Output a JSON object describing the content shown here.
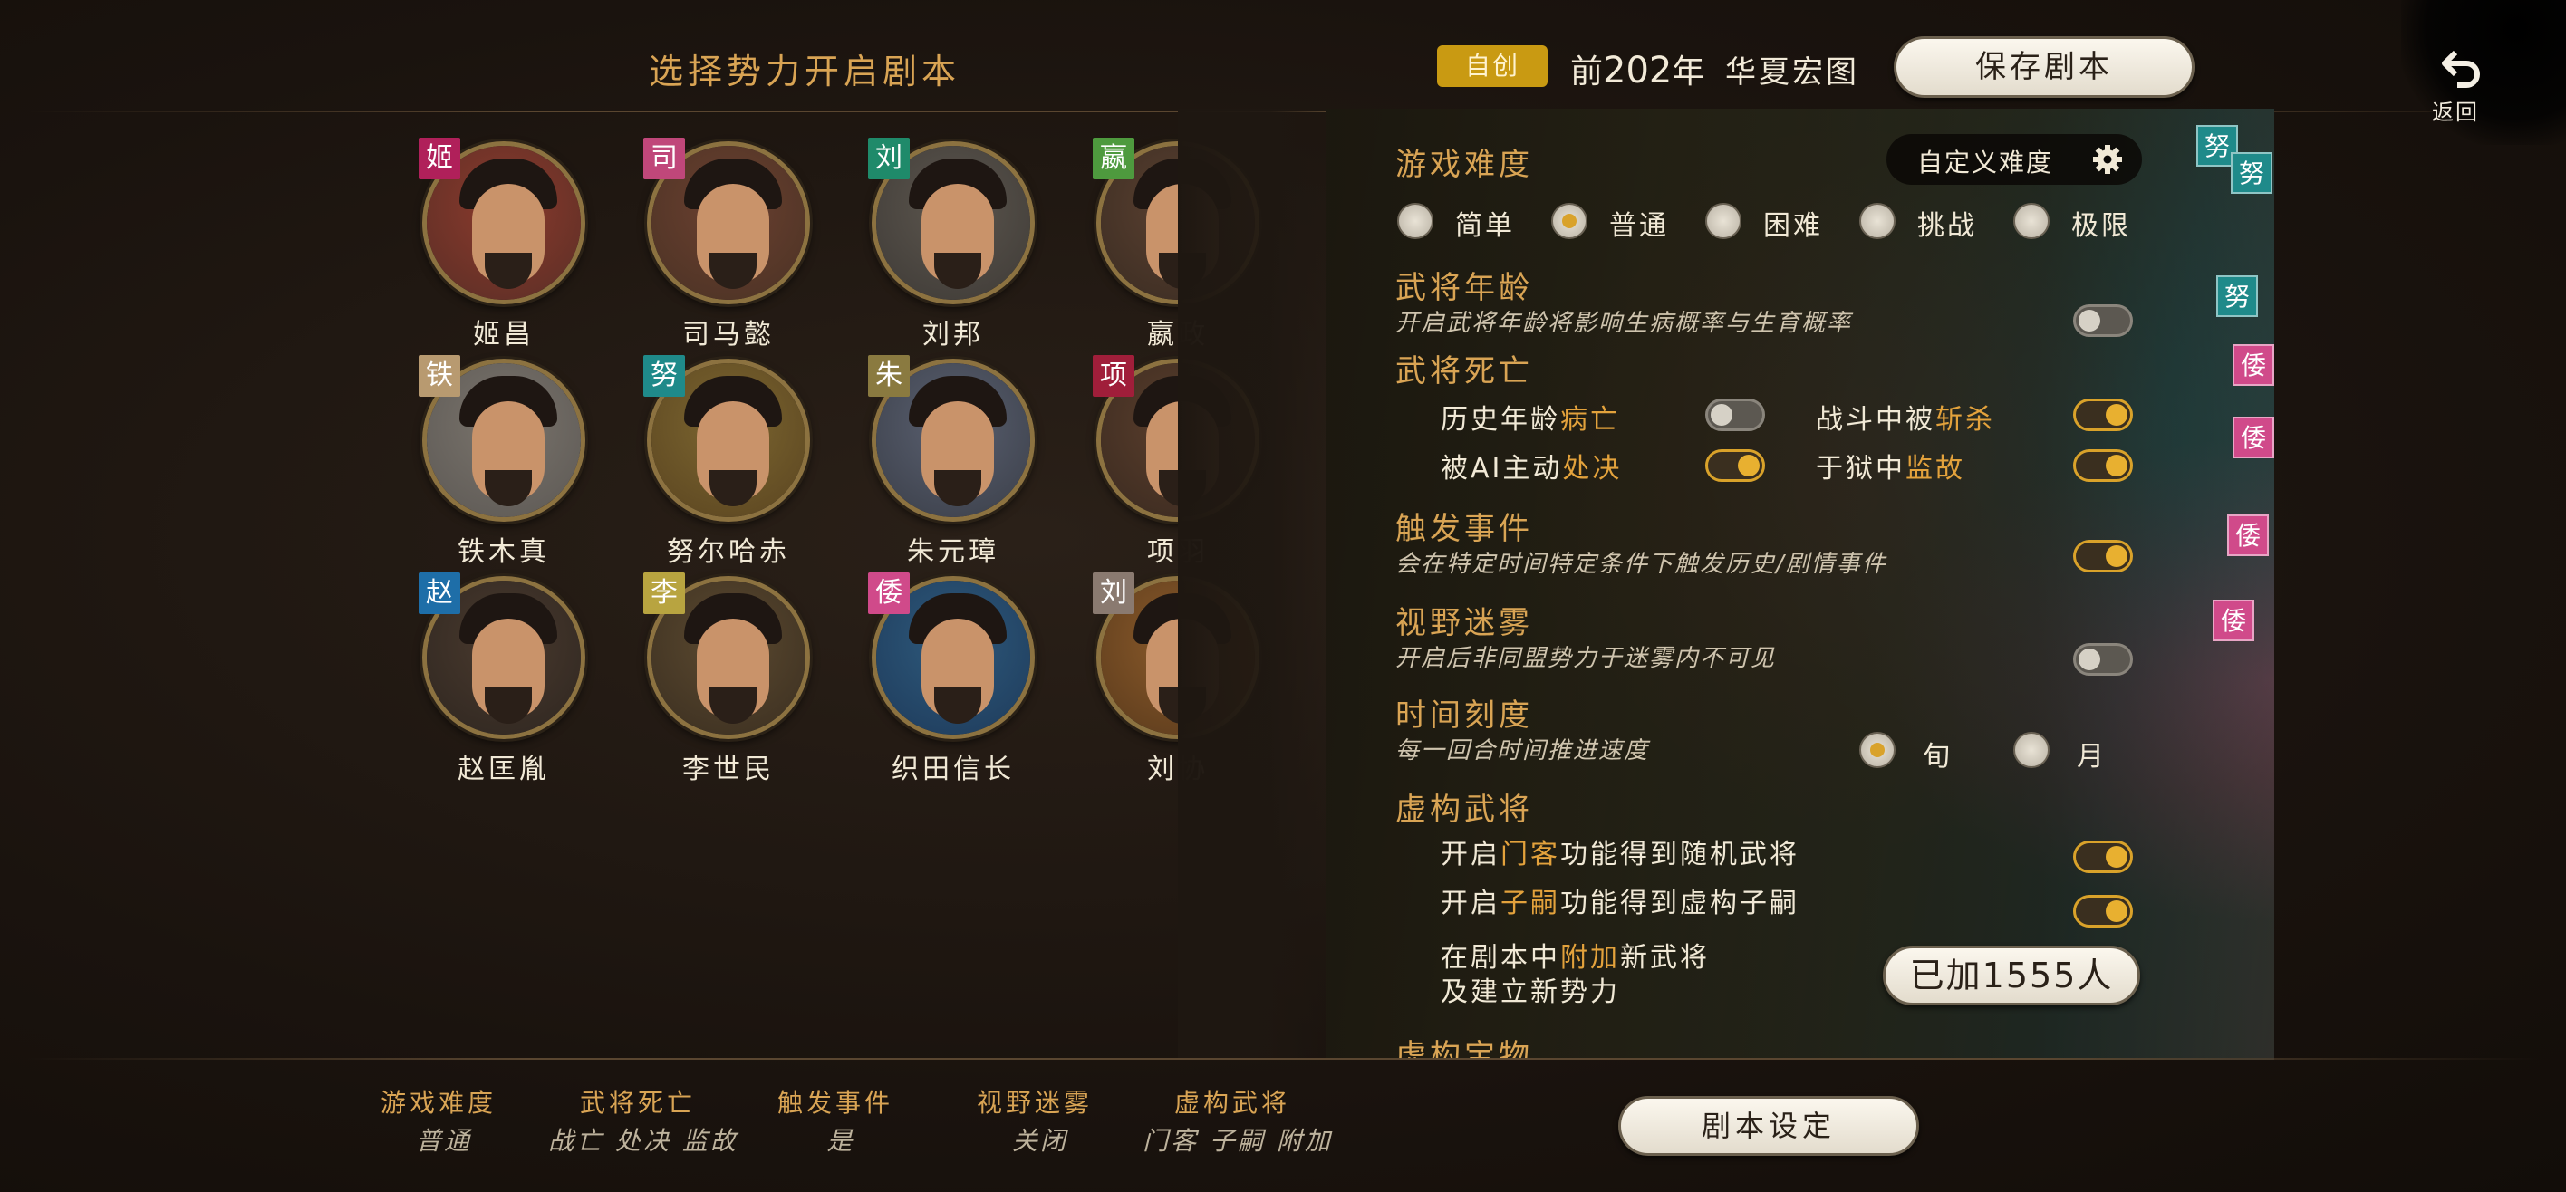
{
  "header": {
    "title": "选择势力开启剧本",
    "badge": "自创",
    "era_prefix": "前",
    "era_year": "202",
    "era_suffix": "年",
    "map_name": "华夏宏图",
    "save_button": "保存剧本",
    "back_label": "返回"
  },
  "characters": [
    {
      "tag": "姬",
      "tag_color": "#b0205a",
      "name": "姬昌"
    },
    {
      "tag": "司",
      "tag_color": "#c0477a",
      "name": "司马懿"
    },
    {
      "tag": "刘",
      "tag_color": "#1f8a6a",
      "name": "刘邦"
    },
    {
      "tag": "嬴",
      "tag_color": "#4e9a3e",
      "name": "嬴政"
    },
    {
      "tag": "铁",
      "tag_color": "#b89a70",
      "name": "铁木真"
    },
    {
      "tag": "努",
      "tag_color": "#1f8a8a",
      "name": "努尔哈赤"
    },
    {
      "tag": "朱",
      "tag_color": "#8a7a40",
      "name": "朱元璋"
    },
    {
      "tag": "项",
      "tag_color": "#a01e3a",
      "name": "项羽"
    },
    {
      "tag": "赵",
      "tag_color": "#1e6ea8",
      "name": "赵匡胤"
    },
    {
      "tag": "李",
      "tag_color": "#b8a440",
      "name": "李世民"
    },
    {
      "tag": "倭",
      "tag_color": "#d04a8a",
      "name": "织田信长"
    },
    {
      "tag": "刘",
      "tag_color": "#8a7a70",
      "name": "刘协"
    }
  ],
  "settings": {
    "difficulty": {
      "title": "游戏难度",
      "custom_label": "自定义难度",
      "options": [
        "简单",
        "普通",
        "困难",
        "挑战",
        "极限"
      ],
      "selected": "普通"
    },
    "age": {
      "title": "武将年龄",
      "desc": "开启武将年龄将影响生病概率与生育概率",
      "enabled": false
    },
    "death": {
      "title": "武将死亡",
      "natural_pre": "历史年龄",
      "natural_hl": "病亡",
      "natural_on": false,
      "battle_pre": "战斗中被",
      "battle_hl": "斩杀",
      "battle_on": true,
      "executed_pre": "被AI主动",
      "executed_hl": "处决",
      "executed_on": true,
      "prison_pre": "于狱中",
      "prison_hl": "监故",
      "prison_on": true
    },
    "events": {
      "title": "触发事件",
      "desc": "会在特定时间特定条件下触发历史/剧情事件",
      "enabled": true
    },
    "fog": {
      "title": "视野迷雾",
      "desc": "开启后非同盟势力于迷雾内不可见",
      "enabled": false
    },
    "time": {
      "title": "时间刻度",
      "desc": "每一回合时间推进速度",
      "options": [
        "旬",
        "月"
      ],
      "selected": "旬"
    },
    "fictional": {
      "title": "虚构武将",
      "guest_pre": "开启",
      "guest_hl": "门客",
      "guest_post": "功能得到随机武将",
      "guest_on": true,
      "heir_pre": "开启",
      "heir_hl": "子嗣",
      "heir_post": "功能得到虚构子嗣",
      "heir_on": true,
      "add_line1_pre": "在剧本中",
      "add_line1_hl": "附加",
      "add_line1_post": "新武将",
      "add_line2": "及建立新势力",
      "added_button": "已加1555人"
    },
    "treasure": {
      "title": "虚构宝物"
    }
  },
  "map_tags": [
    {
      "text": "努",
      "color": "#1f8a8a"
    },
    {
      "text": "努",
      "color": "#1f8a8a"
    },
    {
      "text": "努",
      "color": "#1f8a8a"
    },
    {
      "text": "倭",
      "color": "#d04a8a"
    },
    {
      "text": "倭",
      "color": "#d04a8a"
    },
    {
      "text": "倭",
      "color": "#d04a8a"
    },
    {
      "text": "倭",
      "color": "#d04a8a"
    }
  ],
  "summary": {
    "items": [
      {
        "head": "游戏难度",
        "val": "普通"
      },
      {
        "head": "武将死亡",
        "val": "战亡 处决 监故"
      },
      {
        "head": "触发事件",
        "val": "是"
      },
      {
        "head": "视野迷雾",
        "val": "关闭"
      },
      {
        "head": "虚构武将",
        "val": "门客 子嗣 附加"
      }
    ],
    "script_button": "剧本设定"
  },
  "colors": {
    "accent_gold": "#d9a454",
    "highlight": "#e3a23c",
    "toggle_on": "#e8b030"
  }
}
